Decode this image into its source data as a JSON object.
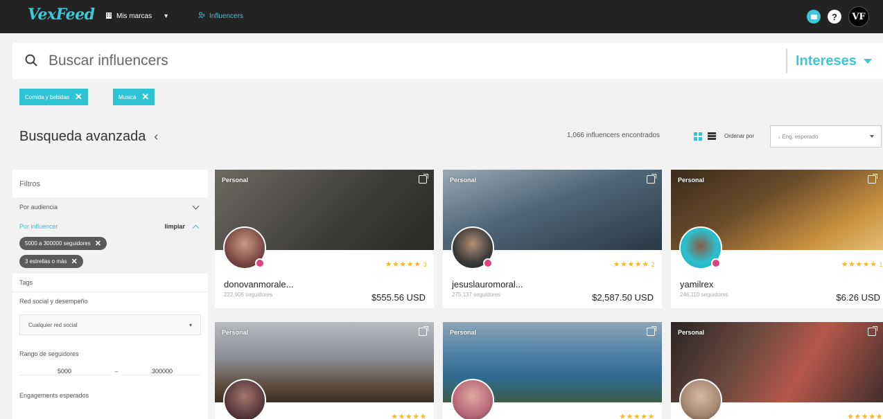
{
  "app": {
    "logo": "VexFeed"
  },
  "nav": {
    "brands_label": "Mis marcas",
    "influencers_label": "Influencers",
    "user_initials": "VF",
    "help_label": "?"
  },
  "search": {
    "placeholder": "Buscar influencers",
    "interests_label": "Intereses"
  },
  "chips": [
    {
      "label": "Comida y bebidas"
    },
    {
      "label": "Musica"
    }
  ],
  "header": {
    "title": "Busqueda avanzada",
    "results": "1,066 influencers encontrados",
    "sort_label": "Ordenar por",
    "sort_value": "↓ Eng. esperado"
  },
  "filters": {
    "title": "Filtros",
    "by_audience": "Por audiencia",
    "by_influencer": "Por influencer",
    "clear": "limpiar",
    "active": [
      {
        "label": "5000 a 300000 seguidores"
      },
      {
        "label": "3 estrellas o más"
      }
    ],
    "tags": "Tags",
    "social_label": "Red social y desempeño",
    "social_select": "Cualquier red social",
    "followers_range_label": "Rango de seguidores",
    "range_from": "5000",
    "range_dash": "–",
    "range_to": "300000",
    "engagement_label": "Engagements esperados"
  },
  "cards": [
    {
      "tag": "Personal",
      "handle": "donovanmorale...",
      "followers": "222,906 seguidores",
      "price": "$555.56 USD",
      "rating": 5,
      "rating_count": "3",
      "cover_color": "#5b5a55",
      "avatar_color": "#7d4a44"
    },
    {
      "tag": "Personal",
      "handle": "jesuslauromoral...",
      "followers": "275,137 seguidores",
      "price": "$2,587.50 USD",
      "rating": 5,
      "rating_count": "2",
      "cover_color": "#4f6678",
      "avatar_color": "#3b3b3b"
    },
    {
      "tag": "Personal",
      "handle": "yamilrex",
      "followers": "246,110 seguidores",
      "price": "$6.26 USD",
      "rating": 5,
      "rating_count": "1",
      "cover_color": "#6b4c2a",
      "avatar_color": "#2bc0cf"
    },
    {
      "tag": "Personal",
      "cover_color": "#8a8e94",
      "avatar_color": "#5a3a40"
    },
    {
      "tag": "Personal",
      "cover_color": "#4d7fa6",
      "avatar_color": "#b86a7a"
    },
    {
      "tag": "Personal",
      "cover_color": "#b6574a",
      "avatar_color": "#a58872"
    }
  ],
  "colors": {
    "accent": "#2ec4d6",
    "nav_bg": "#232323",
    "star": "#f5b82e"
  }
}
